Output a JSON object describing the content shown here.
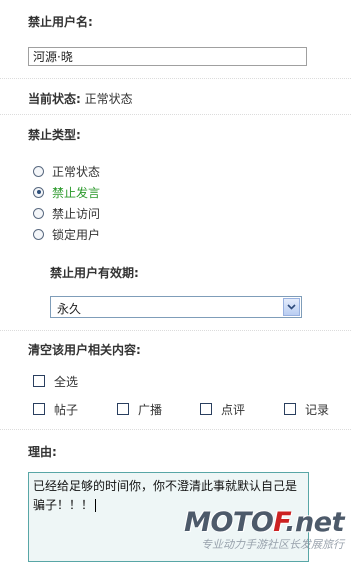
{
  "ban_username": {
    "label": "禁止用户名:",
    "value": "河源·晓"
  },
  "current_status": {
    "label": "当前状态:",
    "value": "正常状态"
  },
  "ban_type": {
    "label": "禁止类型:",
    "options": [
      {
        "label": "正常状态",
        "checked": false
      },
      {
        "label": "禁止发言",
        "checked": true
      },
      {
        "label": "禁止访问",
        "checked": false
      },
      {
        "label": "锁定用户",
        "checked": false
      }
    ]
  },
  "validity": {
    "label": "禁止用户有效期:",
    "selected": "永久"
  },
  "clear_content": {
    "label": "清空该用户相关内容:",
    "select_all": "全选",
    "items": [
      "帖子",
      "广播",
      "点评",
      "记录"
    ]
  },
  "reason": {
    "label": "理由:",
    "text": "已经给足够的时间你，你不澄清此事就默认自己是骗子！！！"
  },
  "watermark": {
    "brand_prefix": "MOTO",
    "brand_accent": "F",
    "brand_suffix": ".net",
    "tagline": "专业动力手游社区长发展旅行"
  },
  "colors": {
    "active_option": "#2c9a2c",
    "brand_accent": "#cc2222",
    "reason_bg": "#eef6f6",
    "reason_border": "#58a6a6"
  }
}
